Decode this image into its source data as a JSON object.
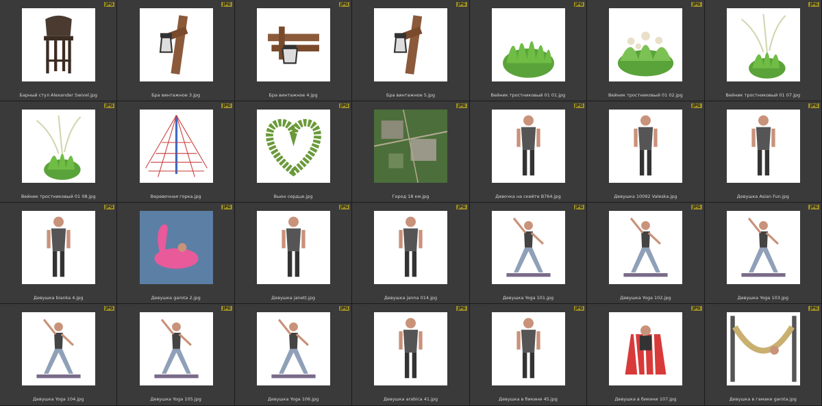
{
  "badge_label": "JPG",
  "items": [
    {
      "name": "Барный стул Alexander Swivel.jpg",
      "icon": "bar-stool"
    },
    {
      "name": "Бра винтажное 3.jpg",
      "icon": "wall-lamp"
    },
    {
      "name": "Бра винтажное 4.jpg",
      "icon": "wall-lamp-wide"
    },
    {
      "name": "Бра винтажное 5.jpg",
      "icon": "wall-lamp"
    },
    {
      "name": "Вейник тростниковый 01 01.jpg",
      "icon": "grass"
    },
    {
      "name": "Вейник тростниковый 01 02.jpg",
      "icon": "grass-flower"
    },
    {
      "name": "Вейник тростниковый 01 07.jpg",
      "icon": "grass-tall"
    },
    {
      "name": "Вейник тростниковый 01 08.jpg",
      "icon": "grass-tall"
    },
    {
      "name": "Веревочная горка.jpg",
      "icon": "rope-pyramid"
    },
    {
      "name": "Вьюн сердце.jpg",
      "icon": "heart-vine"
    },
    {
      "name": "Город 18 км.jpg",
      "icon": "city-map"
    },
    {
      "name": "Девочка на скейте B764.jpg",
      "icon": "person"
    },
    {
      "name": "Девушка 10092 Valeska.jpg",
      "icon": "person"
    },
    {
      "name": "Девушка Asian Fun.jpg",
      "icon": "person"
    },
    {
      "name": "Девушка bianka 4.jpg",
      "icon": "person"
    },
    {
      "name": "Девушка garota 2.jpg",
      "icon": "pool-float"
    },
    {
      "name": "Девушка janett.jpg",
      "icon": "person"
    },
    {
      "name": "Девушка janna 014.jpg",
      "icon": "person"
    },
    {
      "name": "Девушка Yoga 101.jpg",
      "icon": "yoga"
    },
    {
      "name": "Девушка Yoga 102.jpg",
      "icon": "yoga"
    },
    {
      "name": "Девушка Yoga 103.jpg",
      "icon": "yoga"
    },
    {
      "name": "Девушка Yoga 104.jpg",
      "icon": "yoga"
    },
    {
      "name": "Девушка Yoga 105.jpg",
      "icon": "yoga"
    },
    {
      "name": "Девушка Yoga 106.jpg",
      "icon": "yoga"
    },
    {
      "name": "Девушка arabica 41.jpg",
      "icon": "person"
    },
    {
      "name": "Девушка в бикини 45.jpg",
      "icon": "person"
    },
    {
      "name": "Девушка в бикини 107.jpg",
      "icon": "beach-chair"
    },
    {
      "name": "Девушка в гамаке garota.jpg",
      "icon": "hammock"
    }
  ]
}
